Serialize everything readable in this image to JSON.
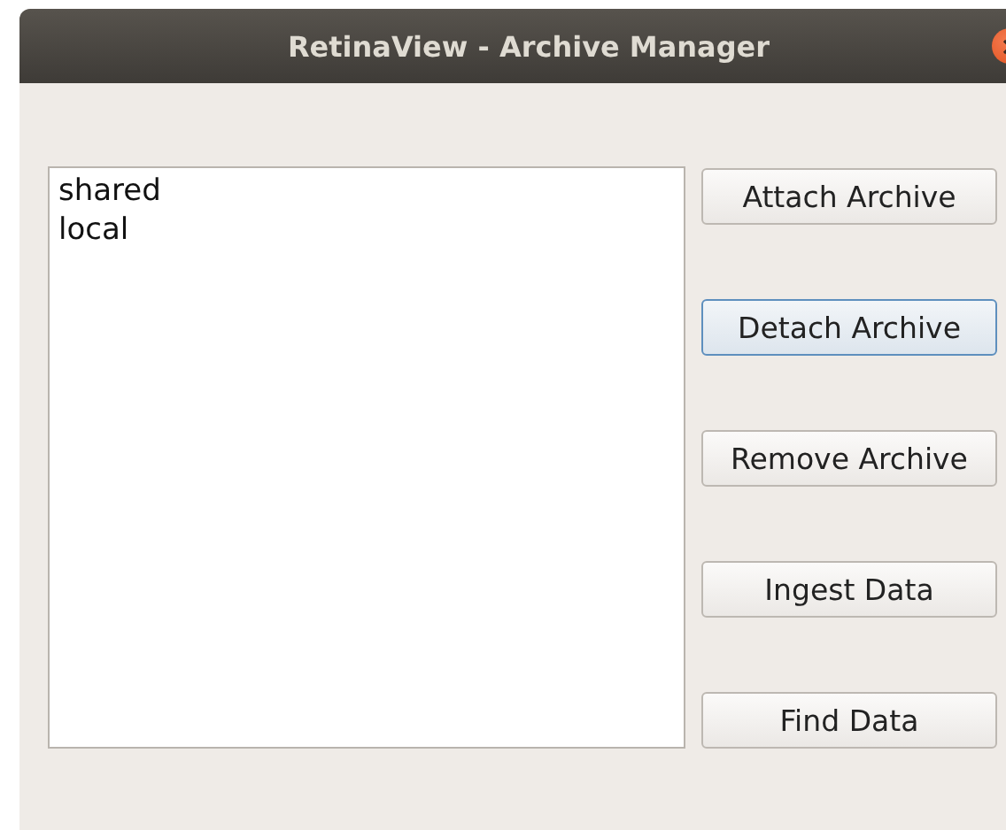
{
  "window": {
    "title": "RetinaView - Archive Manager"
  },
  "archives": {
    "items": [
      {
        "label": "shared",
        "selected": false
      },
      {
        "label": "local",
        "selected": false
      }
    ]
  },
  "buttons": [
    {
      "label": "Attach Archive",
      "focused": false
    },
    {
      "label": "Detach Archive",
      "focused": true
    },
    {
      "label": "Remove Archive",
      "focused": false
    },
    {
      "label": "Ingest Data",
      "focused": false
    },
    {
      "label": "Find Data",
      "focused": false
    }
  ]
}
